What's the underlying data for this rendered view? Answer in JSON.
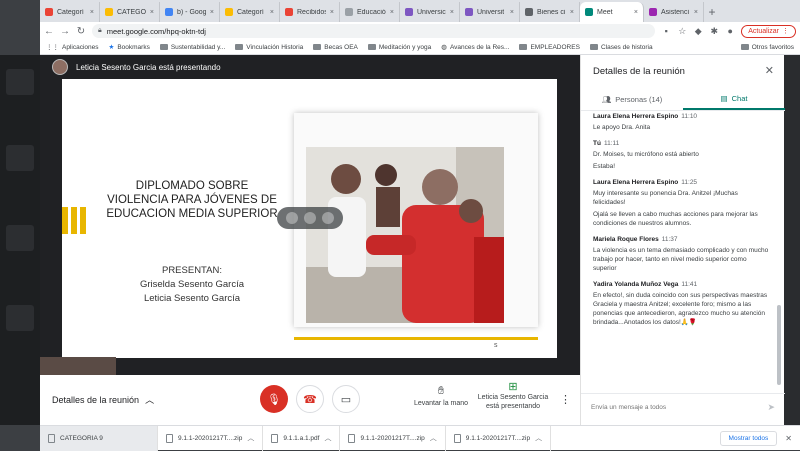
{
  "browser": {
    "tabs": [
      {
        "label": "Categorí",
        "color": "#ea4335"
      },
      {
        "label": "CATEGOR",
        "color": "#fbbc04"
      },
      {
        "label": "b) - Goog",
        "color": "#4285f4"
      },
      {
        "label": "Categorí",
        "color": "#fbbc04"
      },
      {
        "label": "Recibidos",
        "color": "#ea4335"
      },
      {
        "label": "Educació",
        "color": "#9aa0a6"
      },
      {
        "label": "Universic",
        "color": "#7e57c2"
      },
      {
        "label": "Universit",
        "color": "#7e57c2"
      },
      {
        "label": "Bienes ci",
        "color": "#5f6368"
      },
      {
        "label": "Meet",
        "color": "#00897b"
      },
      {
        "label": "Asistenci",
        "color": "#9c27b0"
      }
    ],
    "new_tab": "+",
    "url": "meet.google.com/hpq-oktn-tdj",
    "update_label": "Actualizar"
  },
  "bookmarks": [
    "Aplicaciones",
    "Bookmarks",
    "Sustentabilidad y...",
    "Vinculación Historia",
    "Becas OEA",
    "Meditación y yoga",
    "Avances de la Res...",
    "EMPLEADORES",
    "Clases de historia"
  ],
  "bookmarks_other": "Otros favoritos",
  "meeting": {
    "presenter_banner": "Leticia Sesento Garcia está presentando",
    "slide": {
      "title_lines": [
        "DIPLOMADO SOBRE",
        "VIOLENCIA PARA JÓVENES DE",
        "EDUCACION MEDIA SUPERIOR"
      ],
      "presentan": "PRESENTAN:",
      "authors": [
        "Griselda Sesento García",
        "Leticia Sesento García"
      ],
      "footer_mark": "s"
    },
    "details_label": "Detalles de la reunión",
    "raise_hand": "Levantar la mano",
    "presenting_label": "Leticia Sesento Garcia está presentando"
  },
  "panel": {
    "title": "Detalles de la reunión",
    "tab_people": "Personas (14)",
    "tab_chat": "Chat",
    "messages": [
      {
        "author": "Laura Elena Herrera Espino",
        "time": "11:10",
        "lines": [
          "Le apoyo Dra. Anita"
        ]
      },
      {
        "author": "Tú",
        "time": "11:11",
        "lines": [
          "Dr. Moises, tu micrófono está abierto",
          "Estaba!"
        ]
      },
      {
        "author": "Laura Elena Herrera Espino",
        "time": "11:25",
        "lines": [
          "Muy interesante su ponencia Dra. Anitzel ¡Muchas felicidades!",
          "Ojalá se lleven a cabo muchas acciones para mejorar las condiciones de nuestros alumnos."
        ]
      },
      {
        "author": "Mariela Roque Flores",
        "time": "11:37",
        "lines": [
          "La violencia es un tema demasiado complicado y con mucho trabajo por hacer, tanto en nivel medio superior como superior"
        ]
      },
      {
        "author": "Yadira Yolanda Muñoz Vega",
        "time": "11:41",
        "lines": [
          "En efecto!, sin duda coincido con sus perspectivas maestras Graciela y maestra Anitzel; excelente foro; mismo a las ponencias que antecedieron, agradezco mucho su atención brindada...Anotados los datos!🙏🌹"
        ]
      }
    ],
    "input_placeholder": "Envía un mensaje a todos"
  },
  "downloads": {
    "items": [
      "CATEGORIA 9",
      "9.1.1-20201217T....zip",
      "9.1.1.a.1.pdf",
      "9.1.1-20201217T....zip",
      "9.1.1-20201217T....zip"
    ],
    "show_all": "Mostrar todos"
  }
}
